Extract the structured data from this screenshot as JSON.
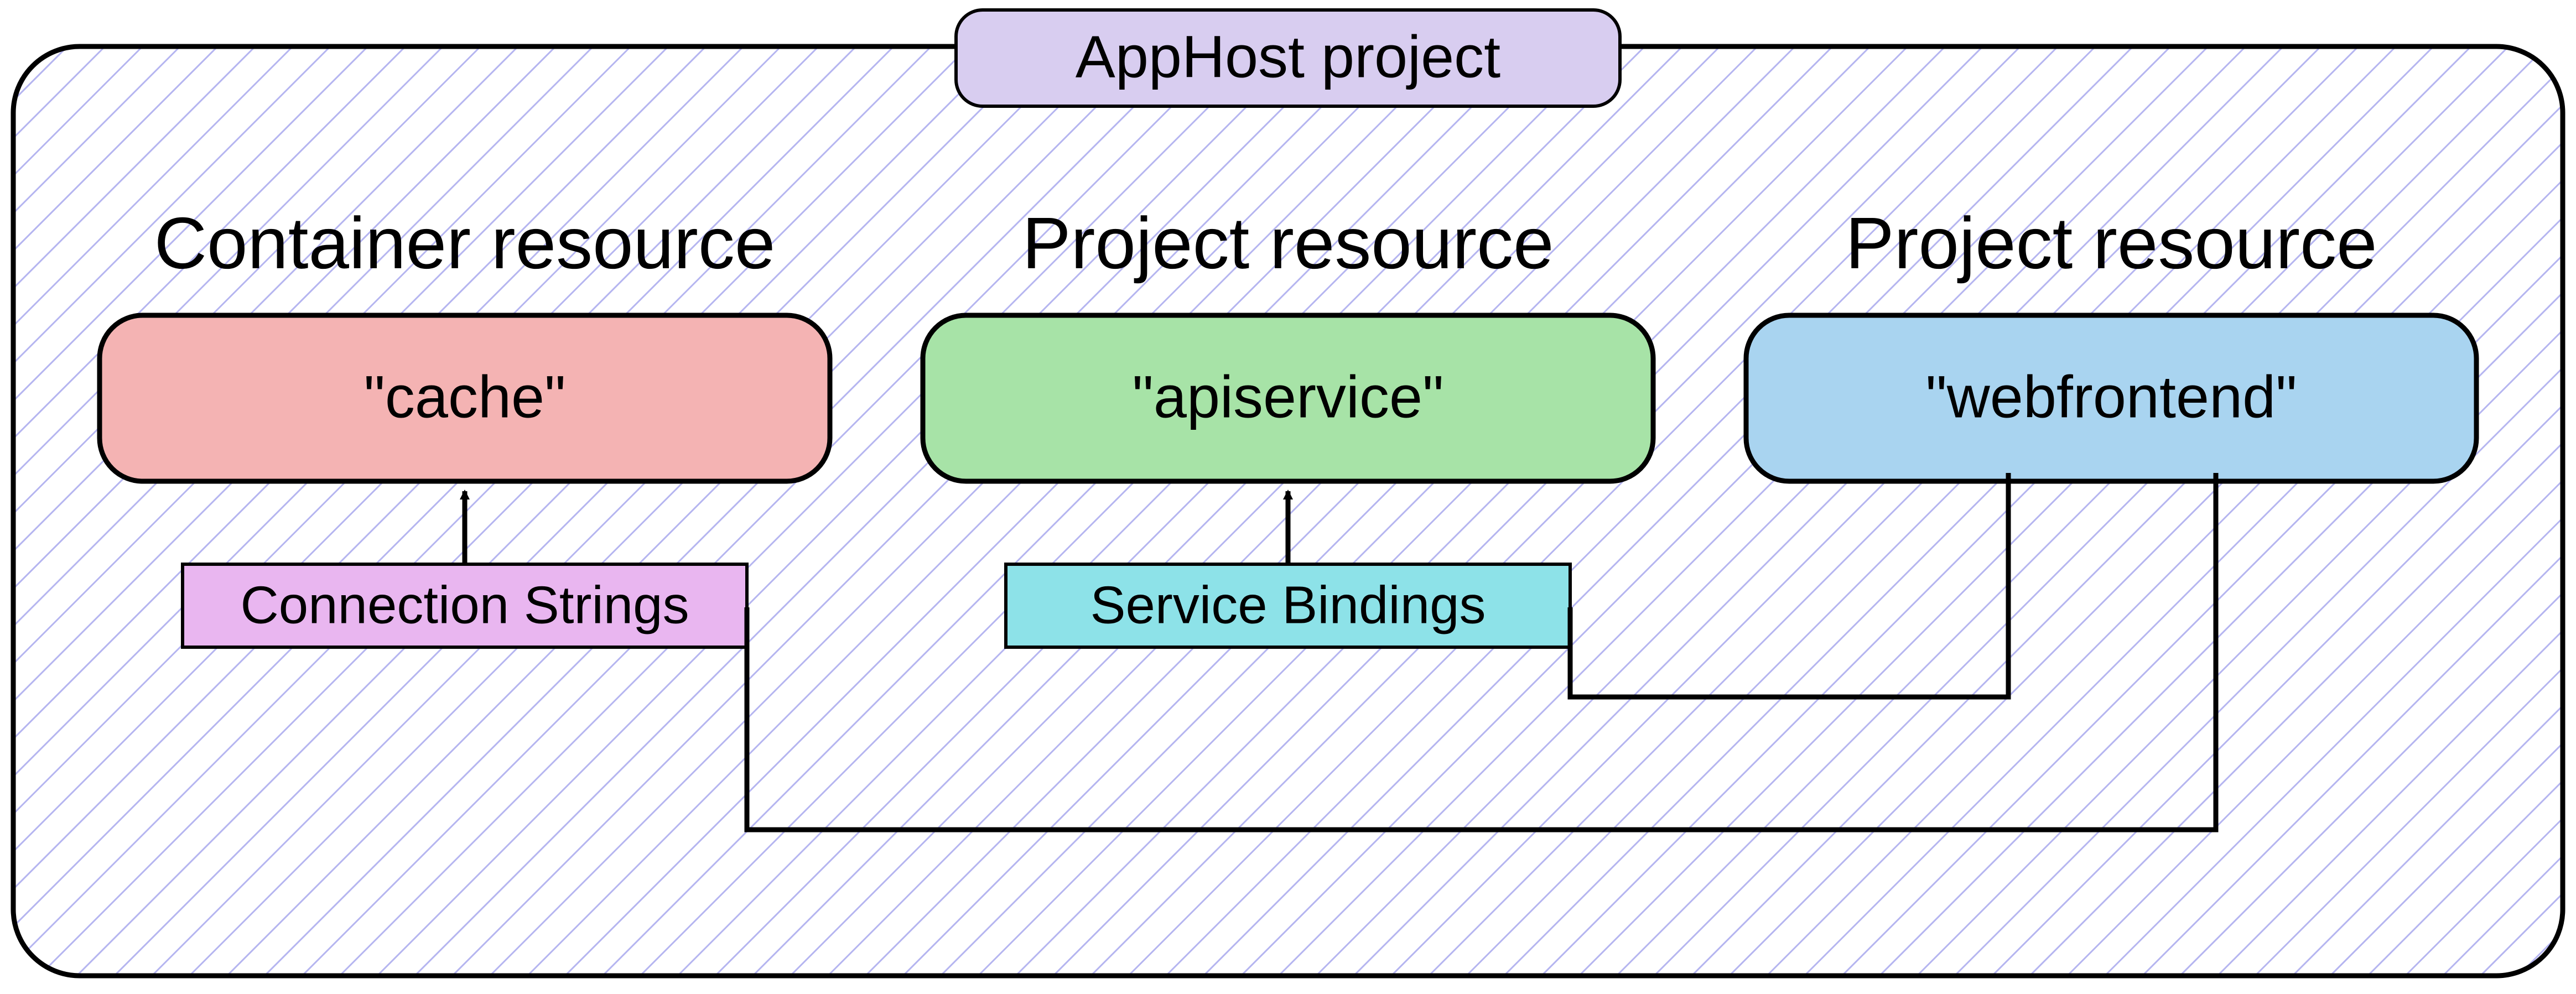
{
  "chart_data": {
    "type": "diagram",
    "title_box": {
      "label": "AppHost project",
      "fill": "#d8cdf0",
      "stroke": "#000000"
    },
    "container": {
      "hatch_stroke": "#b5b5f0",
      "border_stroke": "#000000",
      "border_radius": 40
    },
    "resources": [
      {
        "id": "cache",
        "heading": "Container resource",
        "label": "\"cache\"",
        "fill": "#f4b3b3",
        "stroke": "#000000"
      },
      {
        "id": "apiservice",
        "heading": "Project resource",
        "label": "\"apiservice\"",
        "fill": "#a7e3a7",
        "stroke": "#000000"
      },
      {
        "id": "webfrontend",
        "heading": "Project resource",
        "label": "\"webfrontend\"",
        "fill": "#a9d4f0",
        "stroke": "#000000"
      }
    ],
    "tags": [
      {
        "id": "connection-strings",
        "label": "Connection Strings",
        "fill": "#e9b6f0",
        "stroke": "#000000"
      },
      {
        "id": "service-bindings",
        "label": "Service Bindings",
        "fill": "#8de2e8",
        "stroke": "#000000"
      }
    ],
    "edges": [
      {
        "from": "connection-strings",
        "to": "cache",
        "arrow": "filled"
      },
      {
        "from": "service-bindings",
        "to": "apiservice",
        "arrow": "filled"
      },
      {
        "from": "webfrontend",
        "to": "service-bindings",
        "via": "route-right-down-left",
        "end": "tee"
      },
      {
        "from": "webfrontend",
        "to": "connection-strings",
        "via": "route-far-right-down-left",
        "end": "tee"
      }
    ]
  }
}
